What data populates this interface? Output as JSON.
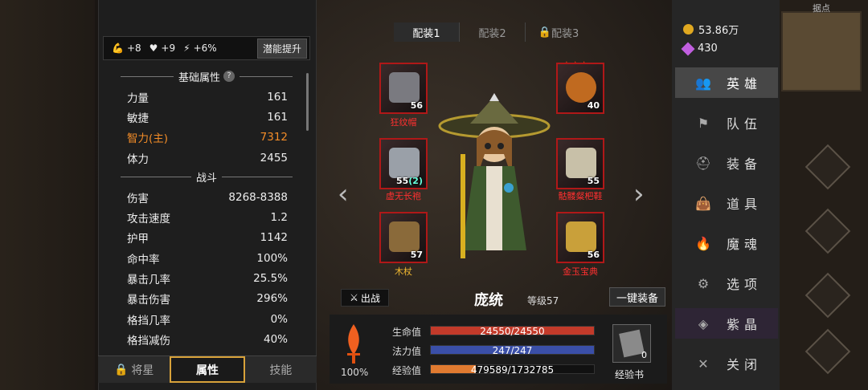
{
  "session_id": "0e297157-74b2-4c44-b351",
  "minimap_title": "据点",
  "boosts": {
    "strength": "+8",
    "health": "+9",
    "speed": "+6%",
    "upgrade_button": "潜能提升"
  },
  "basic_title": "基础属性",
  "basic_stats": [
    {
      "label": "力量",
      "value": "161"
    },
    {
      "label": "敏捷",
      "value": "161"
    },
    {
      "label": "智力(主)",
      "value": "7312"
    },
    {
      "label": "体力",
      "value": "2455"
    }
  ],
  "combat_title": "战斗",
  "combat_stats": [
    {
      "label": "伤害",
      "value": "8268-8388"
    },
    {
      "label": "攻击速度",
      "value": "1.2"
    },
    {
      "label": "护甲",
      "value": "1142"
    },
    {
      "label": "命中率",
      "value": "100%"
    },
    {
      "label": "暴击几率",
      "value": "25.5%"
    },
    {
      "label": "暴击伤害",
      "value": "296%"
    },
    {
      "label": "格挡几率",
      "value": "0%"
    },
    {
      "label": "格挡减伤",
      "value": "40%"
    }
  ],
  "tabs": {
    "general": "将星",
    "attributes": "属性",
    "skills": "技能"
  },
  "loadouts": [
    "配装1",
    "配装2",
    "配装3"
  ],
  "equipment": {
    "hat": {
      "name": "狂纹帽",
      "level": "56"
    },
    "robe": {
      "name": "虚无长袍",
      "level": "55",
      "extra": "(2)"
    },
    "staff": {
      "name": "木杖",
      "level": "57"
    },
    "amulet": {
      "name": "",
      "level": "40",
      "stars": "★★★"
    },
    "shoes": {
      "name": "骷髅粲杷鞋",
      "level": "55"
    },
    "book": {
      "name": "金玉宝典",
      "level": "56"
    }
  },
  "hero": {
    "name": "庞统",
    "level": "等级57",
    "deploy": "出战",
    "auto_equip": "一键装备"
  },
  "bars": {
    "hp": {
      "label": "生命值",
      "text": "24550/24550",
      "fraction": 1.0
    },
    "mp": {
      "label": "法力值",
      "text": "247/247",
      "fraction": 1.0
    },
    "xp": {
      "label": "经验值",
      "text": "479589/1732785",
      "fraction": 0.277
    }
  },
  "rage_pct": "100%",
  "xp_book": {
    "label": "经验书",
    "count": "0"
  },
  "currency": {
    "gold": "53.86万",
    "gems": "430"
  },
  "menu": [
    "英雄",
    "队伍",
    "装备",
    "道具",
    "魔魂",
    "选项",
    "紫晶",
    "关闭"
  ],
  "colors": {
    "hp": "#c23a2a",
    "mp": "#3a4fa8",
    "xp": "#e07a30",
    "highlight": "#f28c28",
    "tab_border": "#d8a23a"
  }
}
